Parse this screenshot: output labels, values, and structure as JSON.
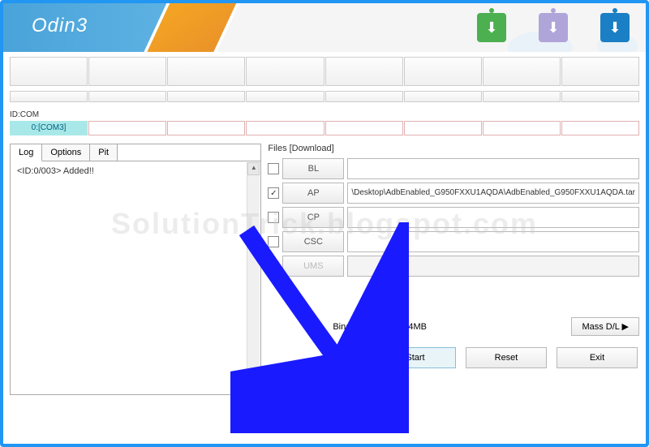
{
  "app": {
    "title": "Odin3"
  },
  "idcom": {
    "label": "ID:COM",
    "value": "0:[COM3]"
  },
  "tabs": {
    "log": "Log",
    "options": "Options",
    "pit": "Pit"
  },
  "log": {
    "line1": "<ID:0/003> Added!!"
  },
  "files": {
    "title": "Files [Download]",
    "bl": {
      "label": "BL",
      "value": ""
    },
    "ap": {
      "label": "AP",
      "value": "\\Desktop\\AdbEnabled_G950FXXU1AQDA\\AdbEnabled_G950FXXU1AQDA.tar",
      "checked": true
    },
    "cp": {
      "label": "CP",
      "value": ""
    },
    "csc": {
      "label": "CSC",
      "value": ""
    },
    "ums": {
      "label": "UMS",
      "value": ""
    }
  },
  "binary": {
    "label": "Binary Size",
    "value": "4MB"
  },
  "buttons": {
    "mass": "Mass D/L ▶",
    "start": "Start",
    "reset": "Reset",
    "exit": "Exit"
  },
  "watermark": "SolutionTrick.blogspot.com"
}
